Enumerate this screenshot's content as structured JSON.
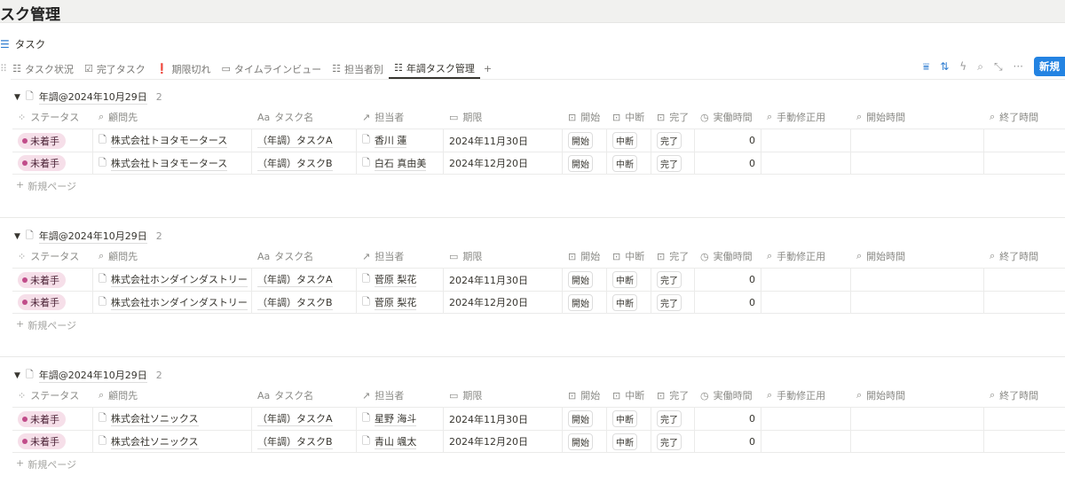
{
  "page": {
    "title": "スク管理"
  },
  "database": {
    "title": "タスク"
  },
  "tabs": [
    {
      "label": "タスク状況",
      "icon": "checklist-icon"
    },
    {
      "label": "完了タスク",
      "icon": "checkbox-icon"
    },
    {
      "label": "期限切れ",
      "icon": "alert-icon"
    },
    {
      "label": "タイムラインビュー",
      "icon": "timeline-icon"
    },
    {
      "label": "担当者別",
      "icon": "checklist-icon"
    },
    {
      "label": "年調タスク管理",
      "icon": "checklist-icon",
      "active": true
    }
  ],
  "toolbar": {
    "new_label": "新規"
  },
  "columns": [
    "ステータス",
    "顧問先",
    "タスク名",
    "担当者",
    "期限",
    "開始",
    "中断",
    "完了",
    "実働時間",
    "手動修正用",
    "開始時間",
    "終了時間"
  ],
  "new_page_label": "新規ページ",
  "groups": [
    {
      "title": "年調@2024年10月29日",
      "count": "2",
      "rows": [
        {
          "status": "未着手",
          "client": "株式会社トヨタモータース",
          "task": "（年調）タスクA",
          "assignee": "香川 蓮",
          "due": "2024年11月30日",
          "start": "開始",
          "pause": "中断",
          "done": "完了",
          "hours": "0"
        },
        {
          "status": "未着手",
          "client": "株式会社トヨタモータース",
          "task": "（年調）タスクB",
          "assignee": "白石 真由美",
          "due": "2024年12月20日",
          "start": "開始",
          "pause": "中断",
          "done": "完了",
          "hours": "0"
        }
      ]
    },
    {
      "title": "年調@2024年10月29日",
      "count": "2",
      "rows": [
        {
          "status": "未着手",
          "client": "株式会社ホンダインダストリー",
          "task": "（年調）タスクA",
          "assignee": "菅原 梨花",
          "due": "2024年11月30日",
          "start": "開始",
          "pause": "中断",
          "done": "完了",
          "hours": "0"
        },
        {
          "status": "未着手",
          "client": "株式会社ホンダインダストリー",
          "task": "（年調）タスクB",
          "assignee": "菅原 梨花",
          "due": "2024年12月20日",
          "start": "開始",
          "pause": "中断",
          "done": "完了",
          "hours": "0"
        }
      ]
    },
    {
      "title": "年調@2024年10月29日",
      "count": "2",
      "rows": [
        {
          "status": "未着手",
          "client": "株式会社ソニックス",
          "task": "（年調）タスクA",
          "assignee": "星野 海斗",
          "due": "2024年11月30日",
          "start": "開始",
          "pause": "中断",
          "done": "完了",
          "hours": "0"
        },
        {
          "status": "未着手",
          "client": "株式会社ソニックス",
          "task": "（年調）タスクB",
          "assignee": "青山 颯太",
          "due": "2024年12月20日",
          "start": "開始",
          "pause": "中断",
          "done": "完了",
          "hours": "0"
        }
      ]
    }
  ],
  "colors": {
    "accent": "#2383e2",
    "status_pill": "#f6dfe9",
    "status_dot": "#c14c8a"
  }
}
